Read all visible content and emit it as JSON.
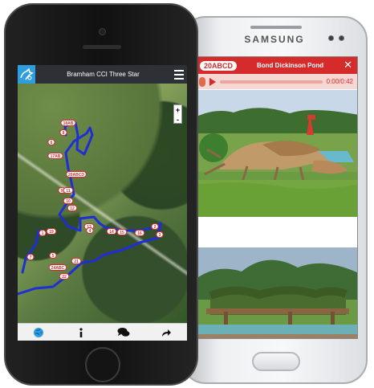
{
  "android": {
    "brand": "SAMSUNG",
    "header": {
      "badge": "20ABCD",
      "title": "Bond Dickinson Pond",
      "close_label": "✕"
    },
    "audio": {
      "time": "0:00/0:42",
      "progress": 0.0
    },
    "colors": {
      "accent": "#d52b2b",
      "audio_bar": "#f7d7d3"
    }
  },
  "iphone": {
    "header": {
      "title": "Bramham CCI Three Star",
      "logo_icon": "horse-logo-icon",
      "menu_icon": "hamburger-menu-icon"
    },
    "map": {
      "zoom_in": "+",
      "zoom_out": "-",
      "fence_labels": [
        "18AB",
        "8",
        "6",
        "17AB",
        "20ABCD",
        "9",
        "10",
        "11",
        "12",
        "13",
        "14",
        "15",
        "16",
        "2",
        "3",
        "19",
        "7",
        "24ABC",
        "22",
        "21",
        "1",
        "4",
        "5"
      ]
    },
    "tabs": [
      {
        "name": "tab-map",
        "icon": "globe-icon"
      },
      {
        "name": "tab-info",
        "icon": "info-icon"
      },
      {
        "name": "tab-chat",
        "icon": "chat-icon"
      },
      {
        "name": "tab-share",
        "icon": "share-icon"
      }
    ],
    "colors": {
      "route": "#1f2fd3",
      "header": "#2d3137",
      "logo": "#2d9ee0"
    }
  }
}
